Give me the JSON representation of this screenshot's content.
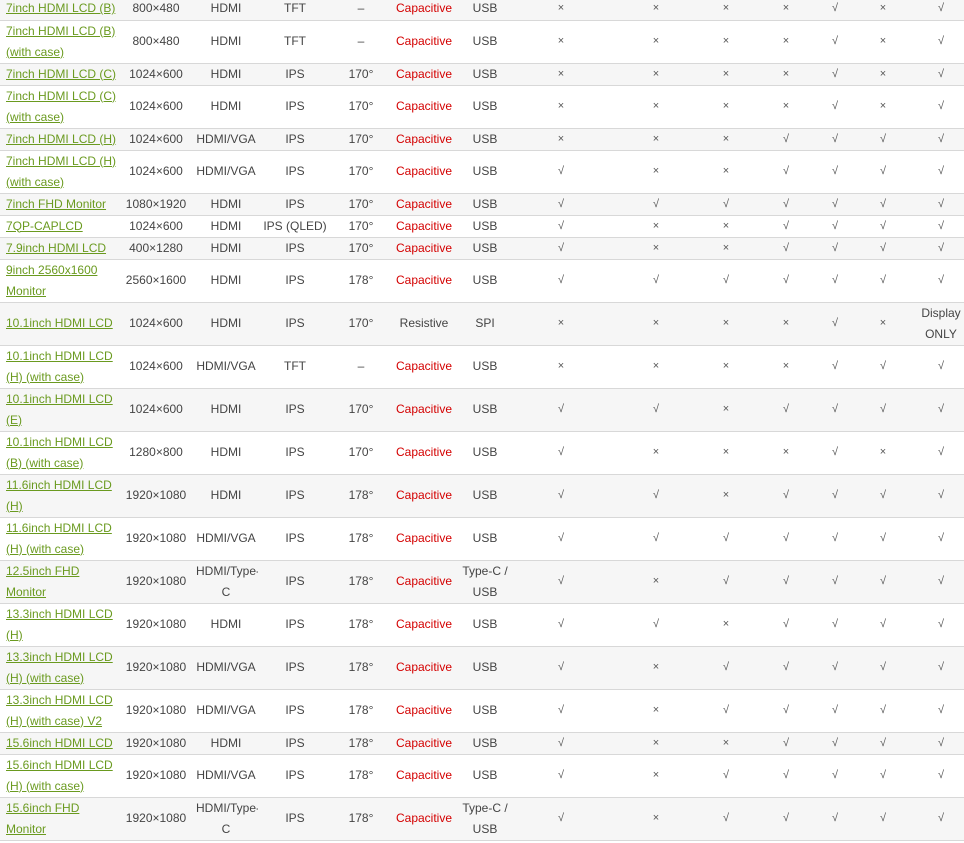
{
  "colors": {
    "link": "#6a9a1f",
    "capacitive": "#d40000",
    "text": "#444444",
    "row_alt": "#f6f6f6",
    "divider": "#d8d8d8"
  },
  "rows": [
    {
      "model": "7inch HDMI LCD (B)",
      "resolution": "800×480",
      "interface": "HDMI",
      "panel": "TFT",
      "angle": "–",
      "touch": "Capacitive",
      "touch_if": "USB",
      "c1": "×",
      "c2": "×",
      "c3": "×",
      "c4": "×",
      "c5": "√",
      "c6": "×",
      "c7": "√"
    },
    {
      "model": "7inch HDMI LCD (B) (with case)",
      "resolution": "800×480",
      "interface": "HDMI",
      "panel": "TFT",
      "angle": "–",
      "touch": "Capacitive",
      "touch_if": "USB",
      "c1": "×",
      "c2": "×",
      "c3": "×",
      "c4": "×",
      "c5": "√",
      "c6": "×",
      "c7": "√"
    },
    {
      "model": "7inch HDMI LCD (C)",
      "resolution": "1024×600",
      "interface": "HDMI",
      "panel": "IPS",
      "angle": "170°",
      "touch": "Capacitive",
      "touch_if": "USB",
      "c1": "×",
      "c2": "×",
      "c3": "×",
      "c4": "×",
      "c5": "√",
      "c6": "×",
      "c7": "√"
    },
    {
      "model": "7inch HDMI LCD (C) (with case)",
      "resolution": "1024×600",
      "interface": "HDMI",
      "panel": "IPS",
      "angle": "170°",
      "touch": "Capacitive",
      "touch_if": "USB",
      "c1": "×",
      "c2": "×",
      "c3": "×",
      "c4": "×",
      "c5": "√",
      "c6": "×",
      "c7": "√"
    },
    {
      "model": "7inch HDMI LCD (H)",
      "resolution": "1024×600",
      "interface": "HDMI/VGA",
      "panel": "IPS",
      "angle": "170°",
      "touch": "Capacitive",
      "touch_if": "USB",
      "c1": "×",
      "c2": "×",
      "c3": "×",
      "c4": "√",
      "c5": "√",
      "c6": "√",
      "c7": "√"
    },
    {
      "model": "7inch HDMI LCD (H) (with case)",
      "resolution": "1024×600",
      "interface": "HDMI/VGA",
      "panel": "IPS",
      "angle": "170°",
      "touch": "Capacitive",
      "touch_if": "USB",
      "c1": "√",
      "c2": "×",
      "c3": "×",
      "c4": "√",
      "c5": "√",
      "c6": "√",
      "c7": "√"
    },
    {
      "model": "7inch FHD Monitor",
      "resolution": "1080×1920",
      "interface": "HDMI",
      "panel": "IPS",
      "angle": "170°",
      "touch": "Capacitive",
      "touch_if": "USB",
      "c1": "√",
      "c2": "√",
      "c3": "√",
      "c4": "√",
      "c5": "√",
      "c6": "√",
      "c7": "√"
    },
    {
      "model": "7QP-CAPLCD",
      "resolution": "1024×600",
      "interface": "HDMI",
      "panel": "IPS (QLED)",
      "angle": "170°",
      "touch": "Capacitive",
      "touch_if": "USB",
      "c1": "√",
      "c2": "×",
      "c3": "×",
      "c4": "√",
      "c5": "√",
      "c6": "√",
      "c7": "√"
    },
    {
      "model": "7.9inch HDMI LCD",
      "resolution": "400×1280",
      "interface": "HDMI",
      "panel": "IPS",
      "angle": "170°",
      "touch": "Capacitive",
      "touch_if": "USB",
      "c1": "√",
      "c2": "×",
      "c3": "×",
      "c4": "√",
      "c5": "√",
      "c6": "√",
      "c7": "√"
    },
    {
      "model": "9inch 2560x1600 Monitor",
      "resolution": "2560×1600",
      "interface": "HDMI",
      "panel": "IPS",
      "angle": "178°",
      "touch": "Capacitive",
      "touch_if": "USB",
      "c1": "√",
      "c2": "√",
      "c3": "√",
      "c4": "√",
      "c5": "√",
      "c6": "√",
      "c7": "√"
    },
    {
      "model": "10.1inch HDMI LCD",
      "resolution": "1024×600",
      "interface": "HDMI",
      "panel": "IPS",
      "angle": "170°",
      "touch": "Resistive",
      "touch_if": "SPI",
      "c1": "×",
      "c2": "×",
      "c3": "×",
      "c4": "×",
      "c5": "√",
      "c6": "×",
      "c7": "Display ONLY"
    },
    {
      "model": "10.1inch HDMI LCD (H) (with case)",
      "resolution": "1024×600",
      "interface": "HDMI/VGA",
      "panel": "TFT",
      "angle": "–",
      "touch": "Capacitive",
      "touch_if": "USB",
      "c1": "×",
      "c2": "×",
      "c3": "×",
      "c4": "×",
      "c5": "√",
      "c6": "√",
      "c7": "√"
    },
    {
      "model": "10.1inch HDMI LCD (E)",
      "resolution": "1024×600",
      "interface": "HDMI",
      "panel": "IPS",
      "angle": "170°",
      "touch": "Capacitive",
      "touch_if": "USB",
      "c1": "√",
      "c2": "√",
      "c3": "×",
      "c4": "√",
      "c5": "√",
      "c6": "√",
      "c7": "√"
    },
    {
      "model": "10.1inch HDMI LCD (B) (with case)",
      "resolution": "1280×800",
      "interface": "HDMI",
      "panel": "IPS",
      "angle": "170°",
      "touch": "Capacitive",
      "touch_if": "USB",
      "c1": "√",
      "c2": "×",
      "c3": "×",
      "c4": "×",
      "c5": "√",
      "c6": "×",
      "c7": "√"
    },
    {
      "model": "11.6inch HDMI LCD (H)",
      "resolution": "1920×1080",
      "interface": "HDMI",
      "panel": "IPS",
      "angle": "178°",
      "touch": "Capacitive",
      "touch_if": "USB",
      "c1": "√",
      "c2": "√",
      "c3": "×",
      "c4": "√",
      "c5": "√",
      "c6": "√",
      "c7": "√"
    },
    {
      "model": "11.6inch HDMI LCD (H) (with case)",
      "resolution": "1920×1080",
      "interface": "HDMI/VGA",
      "panel": "IPS",
      "angle": "178°",
      "touch": "Capacitive",
      "touch_if": "USB",
      "c1": "√",
      "c2": "√",
      "c3": "√",
      "c4": "√",
      "c5": "√",
      "c6": "√",
      "c7": "√"
    },
    {
      "model": "12.5inch FHD Monitor",
      "resolution": "1920×1080",
      "interface": "HDMI/Type-C",
      "panel": "IPS",
      "angle": "178°",
      "touch": "Capacitive",
      "touch_if": "Type-C / USB",
      "c1": "√",
      "c2": "×",
      "c3": "√",
      "c4": "√",
      "c5": "√",
      "c6": "√",
      "c7": "√"
    },
    {
      "model": "13.3inch HDMI LCD (H)",
      "resolution": "1920×1080",
      "interface": "HDMI",
      "panel": "IPS",
      "angle": "178°",
      "touch": "Capacitive",
      "touch_if": "USB",
      "c1": "√",
      "c2": "√",
      "c3": "×",
      "c4": "√",
      "c5": "√",
      "c6": "√",
      "c7": "√"
    },
    {
      "model": "13.3inch HDMI LCD (H) (with case)",
      "resolution": "1920×1080",
      "interface": "HDMI/VGA",
      "panel": "IPS",
      "angle": "178°",
      "touch": "Capacitive",
      "touch_if": "USB",
      "c1": "√",
      "c2": "×",
      "c3": "√",
      "c4": "√",
      "c5": "√",
      "c6": "√",
      "c7": "√"
    },
    {
      "model": "13.3inch HDMI LCD (H) (with case) V2",
      "resolution": "1920×1080",
      "interface": "HDMI/VGA",
      "panel": "IPS",
      "angle": "178°",
      "touch": "Capacitive",
      "touch_if": "USB",
      "c1": "√",
      "c2": "×",
      "c3": "√",
      "c4": "√",
      "c5": "√",
      "c6": "√",
      "c7": "√"
    },
    {
      "model": "15.6inch HDMI LCD",
      "resolution": "1920×1080",
      "interface": "HDMI",
      "panel": "IPS",
      "angle": "178°",
      "touch": "Capacitive",
      "touch_if": "USB",
      "c1": "√",
      "c2": "×",
      "c3": "×",
      "c4": "√",
      "c5": "√",
      "c6": "√",
      "c7": "√"
    },
    {
      "model": "15.6inch HDMI LCD (H) (with case)",
      "resolution": "1920×1080",
      "interface": "HDMI/VGA",
      "panel": "IPS",
      "angle": "178°",
      "touch": "Capacitive",
      "touch_if": "USB",
      "c1": "√",
      "c2": "×",
      "c3": "√",
      "c4": "√",
      "c5": "√",
      "c6": "√",
      "c7": "√"
    },
    {
      "model": "15.6inch FHD Monitor",
      "resolution": "1920×1080",
      "interface": "HDMI/Type-C",
      "panel": "IPS",
      "angle": "178°",
      "touch": "Capacitive",
      "touch_if": "Type-C / USB",
      "c1": "√",
      "c2": "×",
      "c3": "√",
      "c4": "√",
      "c5": "√",
      "c6": "√",
      "c7": "√"
    }
  ]
}
